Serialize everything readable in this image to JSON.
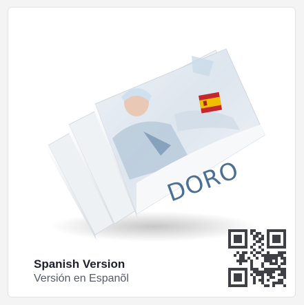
{
  "card": {
    "title": "Spanish Version",
    "subtitle": "Versión en Espanõl"
  },
  "brochure": {
    "brand_text": "DORO",
    "cover_language_flag": "spain-flag"
  },
  "colors": {
    "title": "#1c1f2a",
    "subtitle": "#555a63",
    "brand_text": "#4c6f92",
    "flag_red": "#c6262e",
    "flag_yellow": "#f1bf00",
    "qr": "#3f3f46"
  }
}
